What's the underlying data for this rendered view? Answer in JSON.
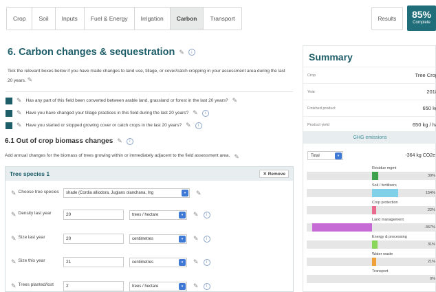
{
  "tabs": [
    {
      "label": "Crop",
      "active": false
    },
    {
      "label": "Soil",
      "active": false
    },
    {
      "label": "Inputs",
      "active": false
    },
    {
      "label": "Fuel & Energy",
      "active": false
    },
    {
      "label": "Irrigation",
      "active": false
    },
    {
      "label": "Carbon",
      "active": true
    },
    {
      "label": "Transport",
      "active": false
    }
  ],
  "header": {
    "results_label": "Results",
    "complete_pct": "85%",
    "complete_label": "Complete"
  },
  "main": {
    "title": "6. Carbon changes & sequestration",
    "intro": "Tick the relevant boxes below if you have made changes to land use, tillage, or cover/catch cropping in your assessment area during the last 20 years.",
    "questions": [
      "Has any part of this field been converted between arable land, grassland or forest in the last 20 years?",
      "Have you have changed your tillage practices in this field during the last 20 years?",
      "Have you started or stopped growing cover or catch crops in the last 20 years?"
    ],
    "section_title": "6.1 Out of crop biomass changes",
    "section_desc": "Add annual changes for the biomass of trees growing within or immediately adjacent to the field assessment area.",
    "panel": {
      "title": "Tree species 1",
      "remove_label": "✕ Remove",
      "species_label": "Choose tree species",
      "species_value": "shade (Cordia alliodora, Juglans olanchana, Ing",
      "fields": [
        {
          "label": "Density last year",
          "value": "20",
          "unit": "trees / hectare"
        },
        {
          "label": "Size last year",
          "value": "20",
          "unit": "centimetres"
        },
        {
          "label": "Size this year",
          "value": "21",
          "unit": "centimetres"
        },
        {
          "label": "Trees planted/lost",
          "value": "2",
          "unit": "trees / hectare"
        }
      ]
    }
  },
  "summary": {
    "title": "Summary",
    "rows": [
      {
        "key": "Crop",
        "value": "Tree Crop"
      },
      {
        "key": "Year",
        "value": "2018"
      },
      {
        "key": "Finished product",
        "value": "650 kg"
      },
      {
        "key": "Product yield",
        "value": "650 kg / ha"
      }
    ],
    "ghg_tab": "GHG emissions",
    "total_select": "Total",
    "total_value": "-364 kg CO2e",
    "categories": [
      {
        "label": "Residue mgmt",
        "pct": "39%",
        "color": "#3da24b",
        "start": 0.5,
        "width": 0.05
      },
      {
        "label": "Soil / fertilisers",
        "pct": "154%",
        "color": "#7fd0e8",
        "start": 0.5,
        "width": 0.2
      },
      {
        "label": "Crop protection",
        "pct": "22%",
        "color": "#e86a8f",
        "start": 0.5,
        "width": 0.03
      },
      {
        "label": "Land management",
        "pct": "-367%",
        "color": "#c66ad6",
        "start": 0.04,
        "width": 0.46
      },
      {
        "label": "Energy & processing",
        "pct": "31%",
        "color": "#8ad65a",
        "start": 0.5,
        "width": 0.04
      },
      {
        "label": "Water waste",
        "pct": "21%",
        "color": "#f0a23a",
        "start": 0.5,
        "width": 0.03
      },
      {
        "label": "Transport",
        "pct": "0%",
        "color": "#bbbbbb",
        "start": 0.5,
        "width": 0.0
      }
    ]
  }
}
